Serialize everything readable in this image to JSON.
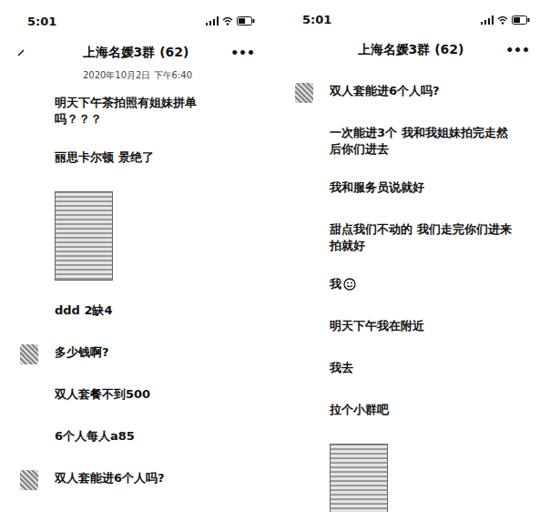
{
  "panels": [
    {
      "status_time": "5:01",
      "title": "上海名媛3群 (62)",
      "more": "•••",
      "back": true,
      "timestamp": "2020年10月2日 下午6:40",
      "messages": [
        {
          "kind": "text",
          "text": "明天下午茶拍照有姐妹拼单吗？？？",
          "avatar": false,
          "emoji": false
        },
        {
          "kind": "text",
          "text": "丽思卡尔顿 景绝了",
          "avatar": false,
          "emoji": false
        },
        {
          "kind": "image",
          "avatar": false
        },
        {
          "kind": "text",
          "text": "ddd 2缺4",
          "avatar": false,
          "emoji": false
        },
        {
          "kind": "text",
          "text": "多少钱啊?",
          "avatar": true,
          "emoji": false
        },
        {
          "kind": "text",
          "text": "双人套餐不到500",
          "avatar": false,
          "emoji": false
        },
        {
          "kind": "text",
          "text": "6个人每人a85",
          "avatar": false,
          "emoji": false
        },
        {
          "kind": "text",
          "text": "双人套能进6个人吗?",
          "avatar": true,
          "emoji": false
        }
      ]
    },
    {
      "status_time": "5:01",
      "title": "上海名媛3群 (62)",
      "more": "•••",
      "back": false,
      "messages": [
        {
          "kind": "text",
          "text": "双人套能进6个人吗?",
          "avatar": true,
          "emoji": false
        },
        {
          "kind": "text",
          "text": "一次能进3个 我和我姐妹拍完走然后你们进去",
          "avatar": false,
          "emoji": false
        },
        {
          "kind": "text",
          "text": "我和服务员说就好",
          "avatar": false,
          "emoji": false
        },
        {
          "kind": "text",
          "text": "甜点我们不动的 我们走完你们进来拍就好",
          "avatar": false,
          "emoji": false
        },
        {
          "kind": "text",
          "text": "我",
          "avatar": false,
          "emoji": true
        },
        {
          "kind": "text",
          "text": "明天下午我在附近",
          "avatar": false,
          "emoji": false
        },
        {
          "kind": "text",
          "text": "我去",
          "avatar": false,
          "emoji": false
        },
        {
          "kind": "text",
          "text": "拉个小群吧",
          "avatar": false,
          "emoji": false
        },
        {
          "kind": "image",
          "avatar": false
        }
      ]
    }
  ]
}
